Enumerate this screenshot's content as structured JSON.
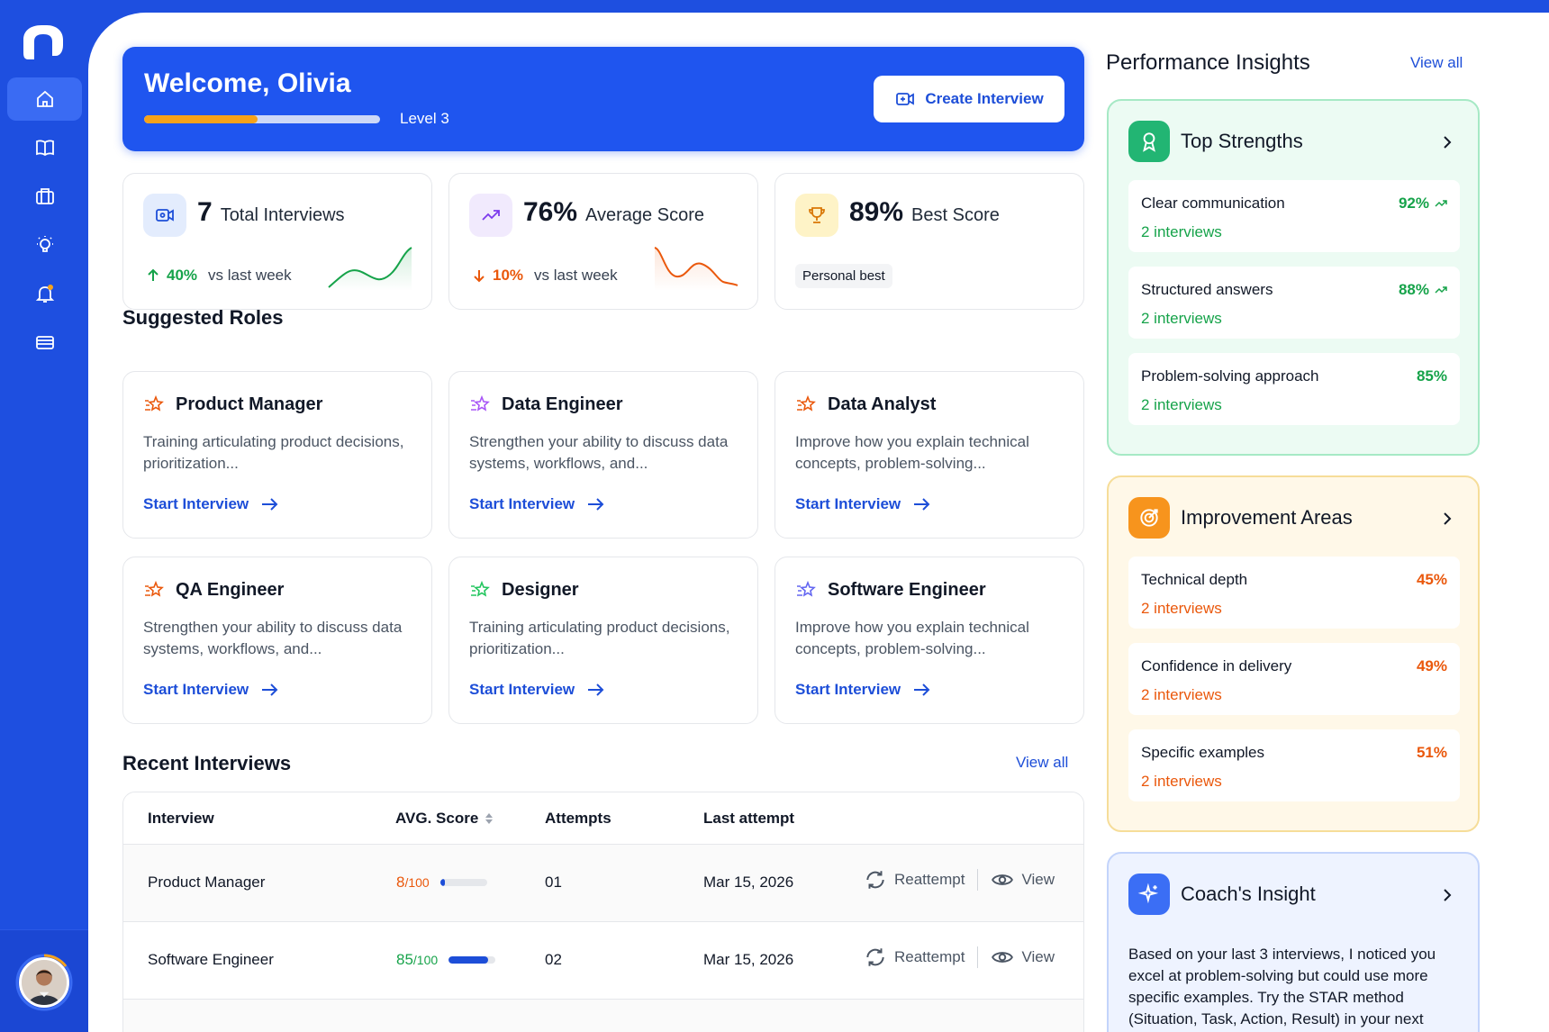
{
  "welcome": {
    "title": "Welcome, Olivia",
    "level": "Level 3",
    "level_progress": 0.48,
    "create_label": "Create Interview"
  },
  "stats": [
    {
      "value": "7",
      "label": "Total Interviews",
      "trend_pct": "40%",
      "trend_text": "vs last week",
      "trend": "up"
    },
    {
      "value": "76%",
      "label": "Average Score",
      "trend_pct": "10%",
      "trend_text": "vs last week",
      "trend": "down"
    },
    {
      "value": "89%",
      "label": "Best Score",
      "badge": "Personal best"
    }
  ],
  "suggested": {
    "title": "Suggested Roles",
    "cta": "Start Interview",
    "roles": [
      {
        "title": "Product Manager",
        "desc": "Training articulating product decisions, prioritization..."
      },
      {
        "title": "Data Engineer",
        "desc": "Strengthen your ability to discuss data systems, workflows, and..."
      },
      {
        "title": "Data Analyst",
        "desc": "Improve how you explain technical concepts, problem-solving..."
      },
      {
        "title": "QA Engineer",
        "desc": "Strengthen your ability to discuss data systems, workflows, and..."
      },
      {
        "title": "Designer",
        "desc": "Training articulating product decisions, prioritization..."
      },
      {
        "title": "Software Engineer",
        "desc": "Improve how you explain technical concepts, problem-solving..."
      }
    ]
  },
  "recent": {
    "title": "Recent Interviews",
    "view_all": "View all",
    "columns": [
      "Interview",
      "AVG. Score",
      "Attempts",
      "Last attempt"
    ],
    "reattempt_label": "Reattempt",
    "view_label": "View",
    "rows": [
      {
        "interview": "Product Manager",
        "score": "8",
        "score_den": "/100",
        "score_fraction": 0.08,
        "attempts": "01",
        "last": "Mar 15, 2026",
        "color": "#ea580c"
      },
      {
        "interview": "Software Engineer",
        "score": "85",
        "score_den": "/100",
        "score_fraction": 0.85,
        "attempts": "02",
        "last": "Mar 15, 2026",
        "color": "#16a34a"
      }
    ]
  },
  "insights": {
    "title": "Performance Insights",
    "view_all": "View all",
    "strengths": {
      "title": "Top Strengths",
      "items": [
        {
          "name": "Clear communication",
          "sub": "2 interviews",
          "pct": "92%"
        },
        {
          "name": "Structured answers",
          "sub": "2 interviews",
          "pct": "88%"
        },
        {
          "name": "Problem-solving approach",
          "sub": "2 interviews",
          "pct": "85%"
        }
      ]
    },
    "improvements": {
      "title": "Improvement Areas",
      "items": [
        {
          "name": "Technical depth",
          "sub": "2 interviews",
          "pct": "45%"
        },
        {
          "name": "Confidence in delivery",
          "sub": "2 interviews",
          "pct": "49%"
        },
        {
          "name": "Specific examples",
          "sub": "2 interviews",
          "pct": "51%"
        }
      ]
    },
    "coach": {
      "title": "Coach's Insight",
      "text": "Based on your last 3 interviews, I noticed you excel at problem-solving but could use more specific examples. Try the STAR method (Situation, Task, Action, Result) in your next behavioral interview!"
    }
  },
  "colors": {
    "brand": "#1f55ef",
    "green": "#16a34a",
    "orange": "#ea580c",
    "progress": "#f6a21a"
  }
}
